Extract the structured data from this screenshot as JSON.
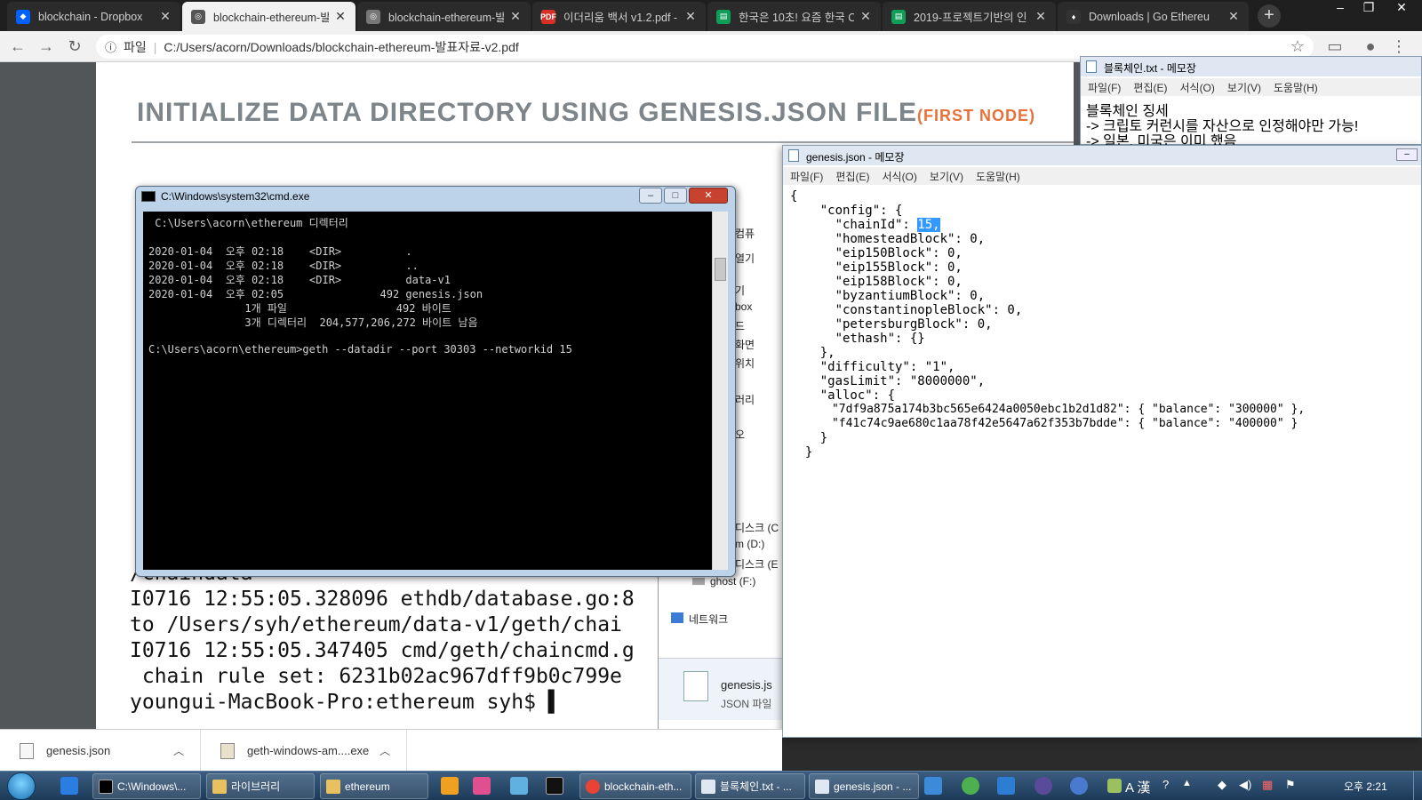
{
  "browser": {
    "tabs": [
      {
        "title": "blockchain - Dropbox",
        "icon": "dropbox-icon"
      },
      {
        "title": "blockchain-ethereum-발표",
        "icon": "globe-icon"
      },
      {
        "title": "blockchain-ethereum-발표",
        "icon": "globe-icon"
      },
      {
        "title": "이더리움 백서 v1.2.pdf -",
        "icon": "pdf-icon"
      },
      {
        "title": "한국은 10초! 요즘 한국 C",
        "icon": "sheet-icon"
      },
      {
        "title": "2019-프로젝트기반의 인",
        "icon": "sheet-icon"
      },
      {
        "title": "Downloads | Go Ethereu",
        "icon": "ethereum-icon"
      }
    ],
    "active_tab": 1,
    "address_label": "파일",
    "address": "C:/Users/acorn/Downloads/blockchain-ethereum-발표자료-v2.pdf"
  },
  "slide": {
    "title": "INITIALIZE DATA DIRECTORY USING GENESIS.JSON FILE",
    "title_sub": "(FIRST NODE)",
    "terminal_lines": [
      "/chaindata",
      "I0716 12:55:05.328096 ethdb/database.go:8",
      "to /Users/syh/ethereum/data-v1/geth/chai",
      "I0716 12:55:05.347405 cmd/geth/chaincmd.g",
      " chain rule set: 6231b02ac967dff9b0c799e",
      "youngui-MacBook-Pro:ethereum syh$ ▌"
    ]
  },
  "cmd": {
    "title": "C:\\Windows\\system32\\cmd.exe",
    "lines": [
      " C:\\Users\\acorn\\ethereum 디렉터리",
      "",
      "2020-01-04  오후 02:18    <DIR>          .",
      "2020-01-04  오후 02:18    <DIR>          ..",
      "2020-01-04  오후 02:18    <DIR>          data-v1",
      "2020-01-04  오후 02:05               492 genesis.json",
      "               1개 파일                 492 바이트",
      "               3개 디렉터리  204,577,206,272 바이트 남음",
      "",
      "C:\\Users\\acorn\\ethereum>geth --datadir --port 30303 --networkid 15"
    ]
  },
  "explorer": {
    "items": [
      "컴퓨",
      "열기",
      "기",
      "box",
      "드",
      "화면",
      "위치",
      "러리",
      "오",
      "디스크 (C",
      "m (D:)",
      "디스크 (E",
      "ghost (F:)",
      "네트워크"
    ],
    "file_name": "genesis.js",
    "file_type": "JSON 파일"
  },
  "notepad1": {
    "title": "블록체인.txt - 메모장",
    "menu": [
      "파일(F)",
      "편집(E)",
      "서식(O)",
      "보기(V)",
      "도움말(H)"
    ],
    "lines": [
      "블록체인 징세",
      "-> 크립토 커런시를 자산으로 인정해야만 가능!",
      "-> 일본, 미국은 이미 했음"
    ]
  },
  "notepad2": {
    "title": "genesis.json - 메모장",
    "menu": [
      "파일(F)",
      "편집(E)",
      "서식(O)",
      "보기(V)",
      "도움말(H)"
    ],
    "lines": [
      "{",
      "    \"config\": {",
      "      \"chainId\": ",
      "      \"homesteadBlock\": 0,",
      "      \"eip150Block\": 0,",
      "      \"eip155Block\": 0,",
      "      \"eip158Block\": 0,",
      "      \"byzantiumBlock\": 0,",
      "      \"constantinopleBlock\": 0,",
      "      \"petersburgBlock\": 0,",
      "      \"ethash\": {}",
      "    },",
      "    \"difficulty\": \"1\",",
      "    \"gasLimit\": \"8000000\",",
      "    \"alloc\": {",
      "      \"7df9a875a174b3bc565e6424a0050ebc1b2d1d82\": { \"balance\": \"300000\" },",
      "      \"f41c74c9ae680c1aa78f42e5647a62f353b7bdde\": { \"balance\": \"400000\" }",
      "    }",
      "  }"
    ],
    "selected_text": "15,"
  },
  "downloads": [
    {
      "name": "genesis.json"
    },
    {
      "name": "geth-windows-am....exe"
    }
  ],
  "taskbar": {
    "buttons": [
      "C:\\Windows\\...",
      "라이브러리",
      "ethereum",
      "blockchain-eth...",
      "블록체인.txt - ...",
      "genesis.json - ..."
    ],
    "clock": "오후 2:21",
    "ime": "A 漢"
  }
}
